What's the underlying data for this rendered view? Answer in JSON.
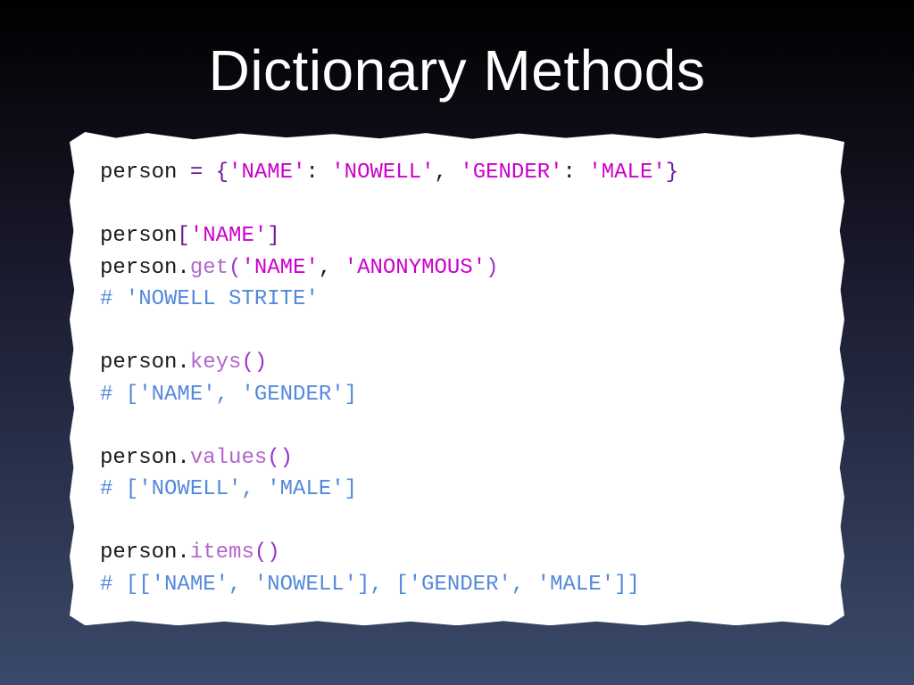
{
  "title": "Dictionary Methods",
  "code": {
    "line1": {
      "var": "person",
      "eq": " = ",
      "open": "{",
      "s1": "'NAME'",
      "c1": ": ",
      "s2": "'NOWELL'",
      "c2": ", ",
      "s3": "'GENDER'",
      "c3": ": ",
      "s4": "'MALE'",
      "close": "}"
    },
    "line3": {
      "var": "person",
      "open": "[",
      "s1": "'NAME'",
      "close": "]"
    },
    "line4": {
      "var": "person",
      "dot": ".",
      "method": "get",
      "open": "(",
      "s1": "'NAME'",
      "c": ", ",
      "s2": "'ANONYMOUS'",
      "close": ")"
    },
    "line5": "# 'NOWELL STRITE'",
    "line7": {
      "var": "person",
      "dot": ".",
      "method": "keys",
      "open": "(",
      "close": ")"
    },
    "line8": "# ['NAME', 'GENDER']",
    "line10": {
      "var": "person",
      "dot": ".",
      "method": "values",
      "open": "(",
      "close": ")"
    },
    "line11": "# ['NOWELL', 'MALE']",
    "line13": {
      "var": "person",
      "dot": ".",
      "method": "items",
      "open": "(",
      "close": ")"
    },
    "line14": "# [['NAME', 'NOWELL'], ['GENDER', 'MALE']]"
  }
}
